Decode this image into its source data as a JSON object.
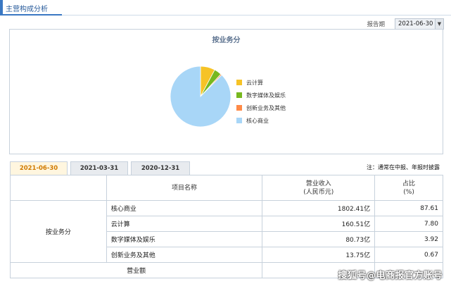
{
  "header": {
    "title": "主营构成分析"
  },
  "report": {
    "label": "报告期",
    "selected": "2021-06-30"
  },
  "colors": {
    "accent": "#3a78c3",
    "tab_active": "#d07a00"
  },
  "chart_data": {
    "type": "pie",
    "title": "按业务分",
    "categories": [
      "核心商业",
      "云计算",
      "数字媒体及娱乐",
      "创新业务及其他"
    ],
    "values": [
      87.61,
      7.8,
      3.92,
      0.67
    ],
    "colors": [
      "#a8d6f7",
      "#f6c326",
      "#77b81f",
      "#ff8a47"
    ],
    "legend": [
      {
        "label": "云计算",
        "color": "#f6c326"
      },
      {
        "label": "数字媒体及娱乐",
        "color": "#77b81f"
      },
      {
        "label": "创新业务及其他",
        "color": "#ff8a47"
      },
      {
        "label": "核心商业",
        "color": "#a8d6f7"
      }
    ],
    "legend_position": "right"
  },
  "tabs": [
    "2021-06-30",
    "2021-03-31",
    "2020-12-31"
  ],
  "note": "注：通常在中报、年报时披露",
  "table": {
    "headers": {
      "name": "项目名称",
      "revenue_line1": "营业收入",
      "revenue_line2": "(人民币元)",
      "pct_line1": "占比",
      "pct_line2": "(%)"
    },
    "segment": "按业务分",
    "rows": [
      {
        "name": "核心商业",
        "revenue": "1802.41亿",
        "pct": "87.61"
      },
      {
        "name": "云计算",
        "revenue": "160.51亿",
        "pct": "7.80"
      },
      {
        "name": "数字媒体及娱乐",
        "revenue": "80.73亿",
        "pct": "3.92"
      },
      {
        "name": "创新业务及其他",
        "revenue": "13.75亿",
        "pct": "0.67"
      }
    ],
    "total_label": "营业额"
  },
  "watermark": "搜狐号@电商报官方账号"
}
